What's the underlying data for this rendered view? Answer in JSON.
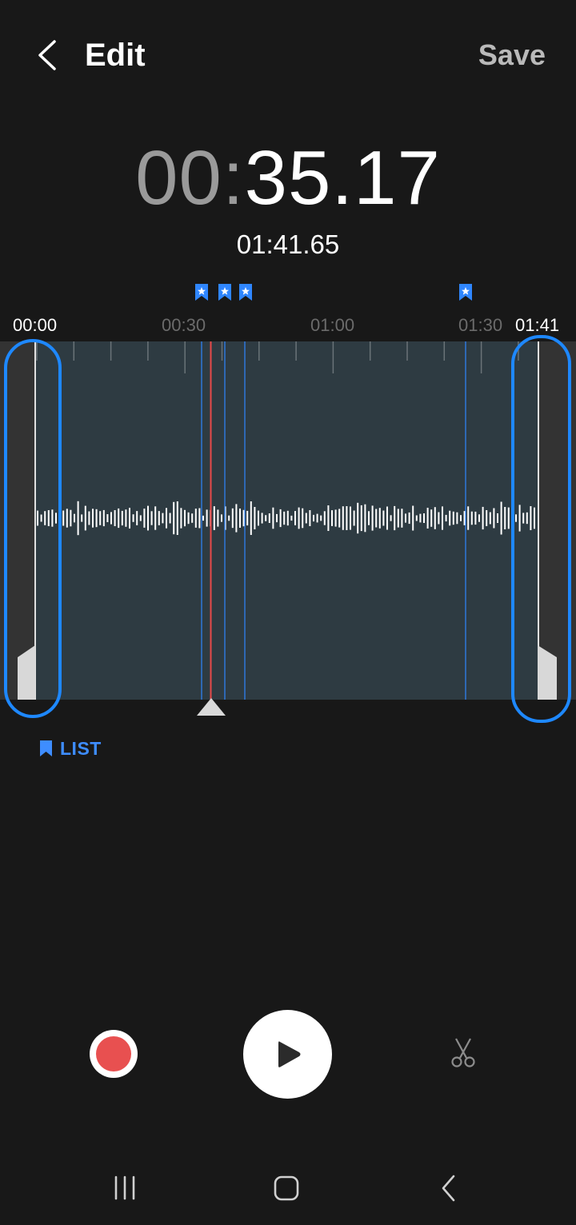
{
  "header": {
    "title": "Edit",
    "save_label": "Save",
    "back_icon": "chevron-left-icon"
  },
  "timer": {
    "minutes": "00",
    "colon": ":",
    "seconds": "35.17",
    "total_duration": "01:41.65"
  },
  "timeline": {
    "labels": [
      "00:00",
      "00:30",
      "01:00",
      "01:30",
      "01:41"
    ],
    "bookmark_count": 4
  },
  "bookmarks": {
    "list_label": "LIST",
    "icon": "bookmark-icon"
  },
  "controls": {
    "record_icon": "record-icon",
    "play_icon": "play-icon",
    "cut_icon": "scissors-icon"
  },
  "navbar": {
    "recents_icon": "recents-icon",
    "home_icon": "home-icon",
    "back_icon": "nav-back-icon"
  },
  "colors": {
    "background": "#181818",
    "accent": "#1e88ff",
    "record": "#e85050",
    "playhead": "#e84a4a",
    "waveform_bg": "#2e3b42"
  }
}
